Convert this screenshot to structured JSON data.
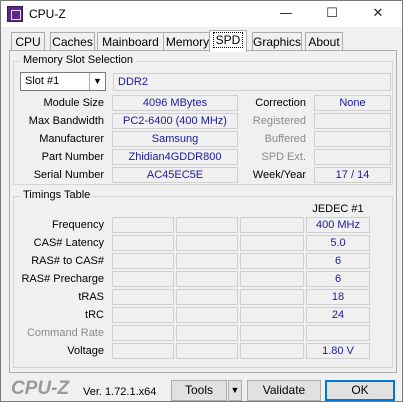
{
  "window": {
    "title": "CPU-Z"
  },
  "icons": {
    "min": "minimize-icon",
    "max": "maximize-icon",
    "close": "close-icon"
  },
  "tabs": [
    "CPU",
    "Caches",
    "Mainboard",
    "Memory",
    "SPD",
    "Graphics",
    "About"
  ],
  "active_tab": "SPD",
  "memory_slot": {
    "group_title": "Memory Slot Selection",
    "slot_value": "Slot #1",
    "mem_type": "DDR2",
    "labels": {
      "module_size": "Module Size",
      "max_bandwidth": "Max Bandwidth",
      "manufacturer": "Manufacturer",
      "part_number": "Part Number",
      "serial_number": "Serial Number",
      "correction": "Correction",
      "registered": "Registered",
      "buffered": "Buffered",
      "spd_ext": "SPD Ext.",
      "week_year": "Week/Year"
    },
    "values": {
      "module_size": "4096 MBytes",
      "max_bandwidth": "PC2-6400 (400 MHz)",
      "manufacturer": "Samsung",
      "part_number": "Zhidian4GDDR800",
      "serial_number": "AC45EC5E",
      "correction": "None",
      "registered": "",
      "buffered": "",
      "spd_ext": "",
      "week_year": "17 / 14"
    }
  },
  "timings": {
    "group_title": "Timings Table",
    "column_header": "JEDEC #1",
    "rows": [
      {
        "label": "Frequency",
        "value": "400 MHz",
        "disabled": false
      },
      {
        "label": "CAS# Latency",
        "value": "5.0",
        "disabled": false
      },
      {
        "label": "RAS# to CAS#",
        "value": "6",
        "disabled": false
      },
      {
        "label": "RAS# Precharge",
        "value": "6",
        "disabled": false
      },
      {
        "label": "tRAS",
        "value": "18",
        "disabled": false
      },
      {
        "label": "tRC",
        "value": "24",
        "disabled": false
      },
      {
        "label": "Command Rate",
        "value": "",
        "disabled": true
      },
      {
        "label": "Voltage",
        "value": "1.80 V",
        "disabled": false
      }
    ]
  },
  "footer": {
    "logo": "CPU-Z",
    "version": "Ver. 1.72.1.x64",
    "tools_label": "Tools",
    "validate_label": "Validate",
    "ok_label": "OK"
  }
}
